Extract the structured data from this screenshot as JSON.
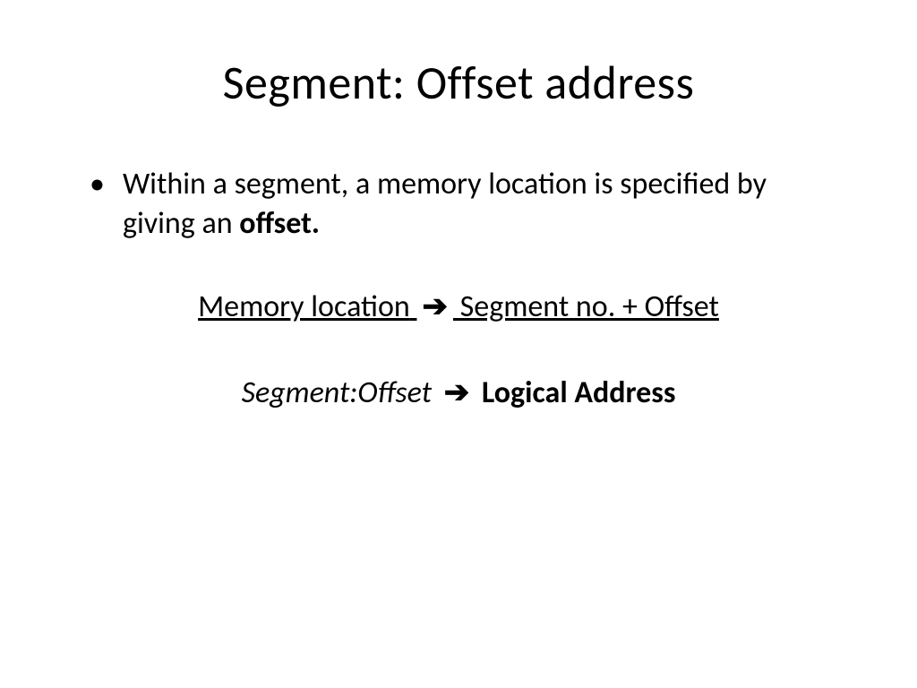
{
  "title": "Segment: Offset address",
  "bullet": {
    "text_before": "Within a segment, a memory location is specified by giving an ",
    "text_bold": "offset."
  },
  "formula1": {
    "part1": "Memory location",
    "arrow": "➔",
    "part2": " Segment no. + Offset"
  },
  "formula2": {
    "part1_italic": "Segment:Offset ",
    "arrow": "➔",
    "part2_bold": " Logical Address"
  }
}
